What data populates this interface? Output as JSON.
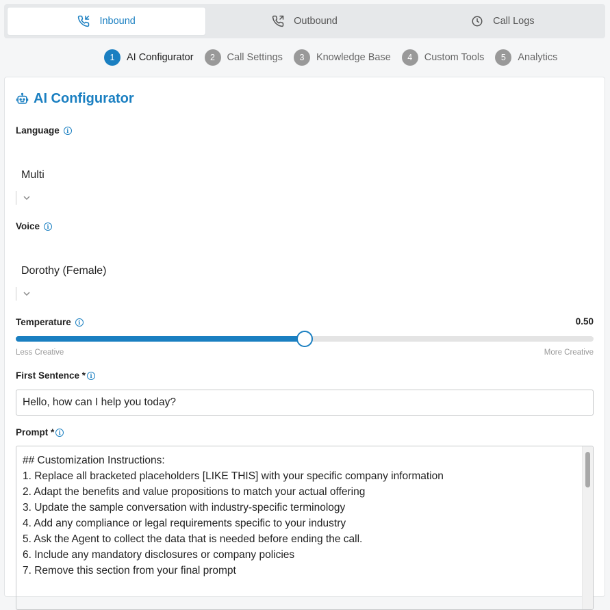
{
  "tabs": [
    {
      "label": "Inbound",
      "icon": "phone-incoming-icon",
      "active": true
    },
    {
      "label": "Outbound",
      "icon": "phone-outgoing-icon",
      "active": false
    },
    {
      "label": "Call Logs",
      "icon": "clock-icon",
      "active": false
    }
  ],
  "steps": [
    {
      "num": "1",
      "label": "AI Configurator",
      "active": true
    },
    {
      "num": "2",
      "label": "Call Settings",
      "active": false
    },
    {
      "num": "3",
      "label": "Knowledge Base",
      "active": false
    },
    {
      "num": "4",
      "label": "Custom Tools",
      "active": false
    },
    {
      "num": "5",
      "label": "Analytics",
      "active": false
    }
  ],
  "card": {
    "title": "AI Configurator",
    "icon": "robot-icon"
  },
  "language": {
    "label": "Language",
    "value": "Multi"
  },
  "voice": {
    "label": "Voice",
    "value": "Dorothy (Female)"
  },
  "temperature": {
    "label": "Temperature",
    "value": "0.50",
    "fraction": 0.5,
    "min_label": "Less Creative",
    "max_label": "More Creative"
  },
  "first_sentence": {
    "label": "First Sentence *",
    "value": "Hello, how can I help you today?"
  },
  "prompt": {
    "label": "Prompt *",
    "lines": [
      "## Customization Instructions:",
      "1. Replace all bracketed placeholders [LIKE THIS] with your specific company information",
      "2. Adapt the benefits and value propositions to match your actual offering",
      "3. Update the sample conversation with industry-specific terminology",
      "4. Add any compliance or legal requirements specific to your industry",
      "5. Ask the Agent to collect the data that is needed before ending the call.",
      "6. Include any mandatory disclosures or company policies",
      "7. Remove this section from your final prompt"
    ]
  },
  "colors": {
    "accent": "#1a7fc1",
    "step_inactive": "#999999"
  }
}
